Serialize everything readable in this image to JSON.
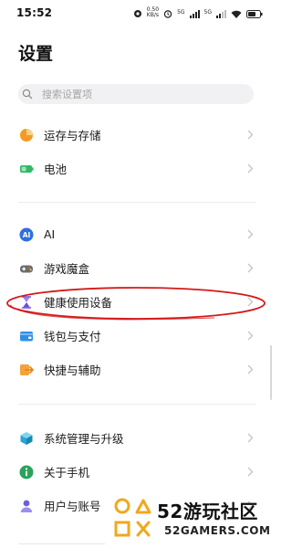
{
  "status_bar": {
    "time": "15:52",
    "speed_top": "0.50",
    "speed_bottom": "KB/s",
    "sim1": "5G",
    "sim2": "5G"
  },
  "header": {
    "title": "设置"
  },
  "search": {
    "placeholder": "搜索设置项"
  },
  "groups": [
    {
      "items": [
        {
          "label": "运存与存储",
          "icon": "storage-pie-icon",
          "color": "#f59a23"
        },
        {
          "label": "电池",
          "icon": "battery-icon",
          "color": "#2fb866"
        }
      ]
    },
    {
      "items": [
        {
          "label": "AI",
          "icon": "ai-icon",
          "color": "#2f6fe0"
        },
        {
          "label": "游戏魔盒",
          "icon": "gamepad-icon",
          "color": "#6b6b6b"
        },
        {
          "label": "健康使用设备",
          "icon": "hourglass-icon",
          "color": "#6b4fd8"
        },
        {
          "label": "钱包与支付",
          "icon": "wallet-icon",
          "color": "#2f8fe6"
        },
        {
          "label": "快捷与辅助",
          "icon": "shortcut-icon",
          "color": "#f3a33a"
        }
      ]
    },
    {
      "items": [
        {
          "label": "系统管理与升级",
          "icon": "system-cube-icon",
          "color": "#2aa6d6"
        },
        {
          "label": "关于手机",
          "icon": "info-icon",
          "color": "#29a35a"
        },
        {
          "label": "用户与账号",
          "icon": "user-icon",
          "color": "#6b5fd6"
        }
      ]
    }
  ],
  "watermark": {
    "line1": "52游玩社区",
    "line2": "52GAMERS.COM"
  }
}
